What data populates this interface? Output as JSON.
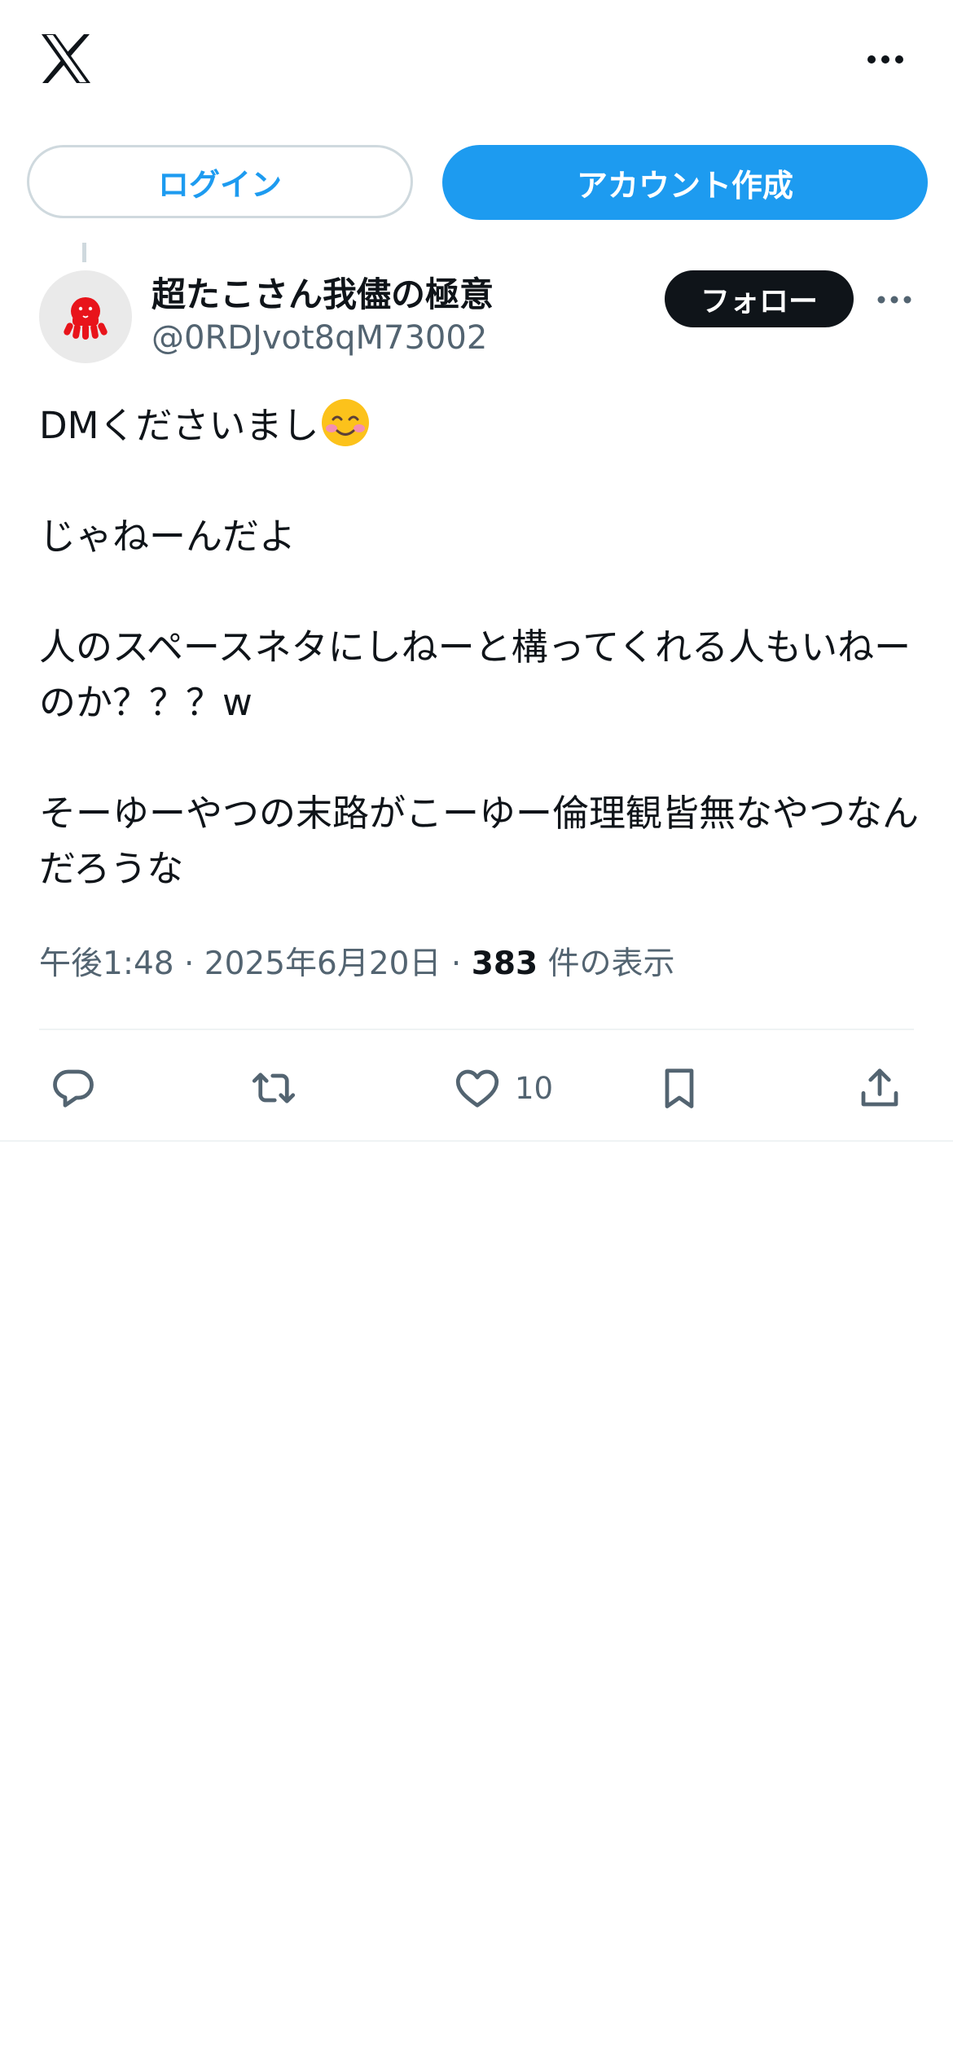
{
  "header": {
    "logo_icon": "x-logo-icon",
    "more_icon": "more-horizontal-icon"
  },
  "auth": {
    "login_label": "ログイン",
    "signup_label": "アカウント作成"
  },
  "post": {
    "avatar_icon": "octopus-icon",
    "display_name": "超たこさん我儘の極意",
    "handle": "@0RDJvot8qM73002",
    "follow_label": "フォロー",
    "more_icon": "more-horizontal-icon",
    "paragraphs": [
      "DMくださいまし",
      "じゃねーんだよ",
      "人のスペースネタにしねーと構ってくれる人もいねーのか？？？w",
      "そーゆーやつの末路がこーゆー倫理観皆無なやつなんだろうな"
    ],
    "emoji_icon": "smiling-face-with-smiling-eyes-emoji",
    "time": "午後1:48",
    "date": "2025年6月20日",
    "views_count": "383",
    "views_label": "件の表示"
  },
  "actions": {
    "reply_icon": "reply-icon",
    "repost_icon": "repost-icon",
    "like_icon": "heart-icon",
    "like_count": "10",
    "bookmark_icon": "bookmark-icon",
    "share_icon": "share-icon"
  },
  "colors": {
    "accent": "#1d9bf0",
    "text_primary": "#0f1419",
    "text_secondary": "#536471",
    "border": "#cfd9de",
    "divider": "#eff3f4",
    "avatar_octopus": "#e8141b"
  }
}
